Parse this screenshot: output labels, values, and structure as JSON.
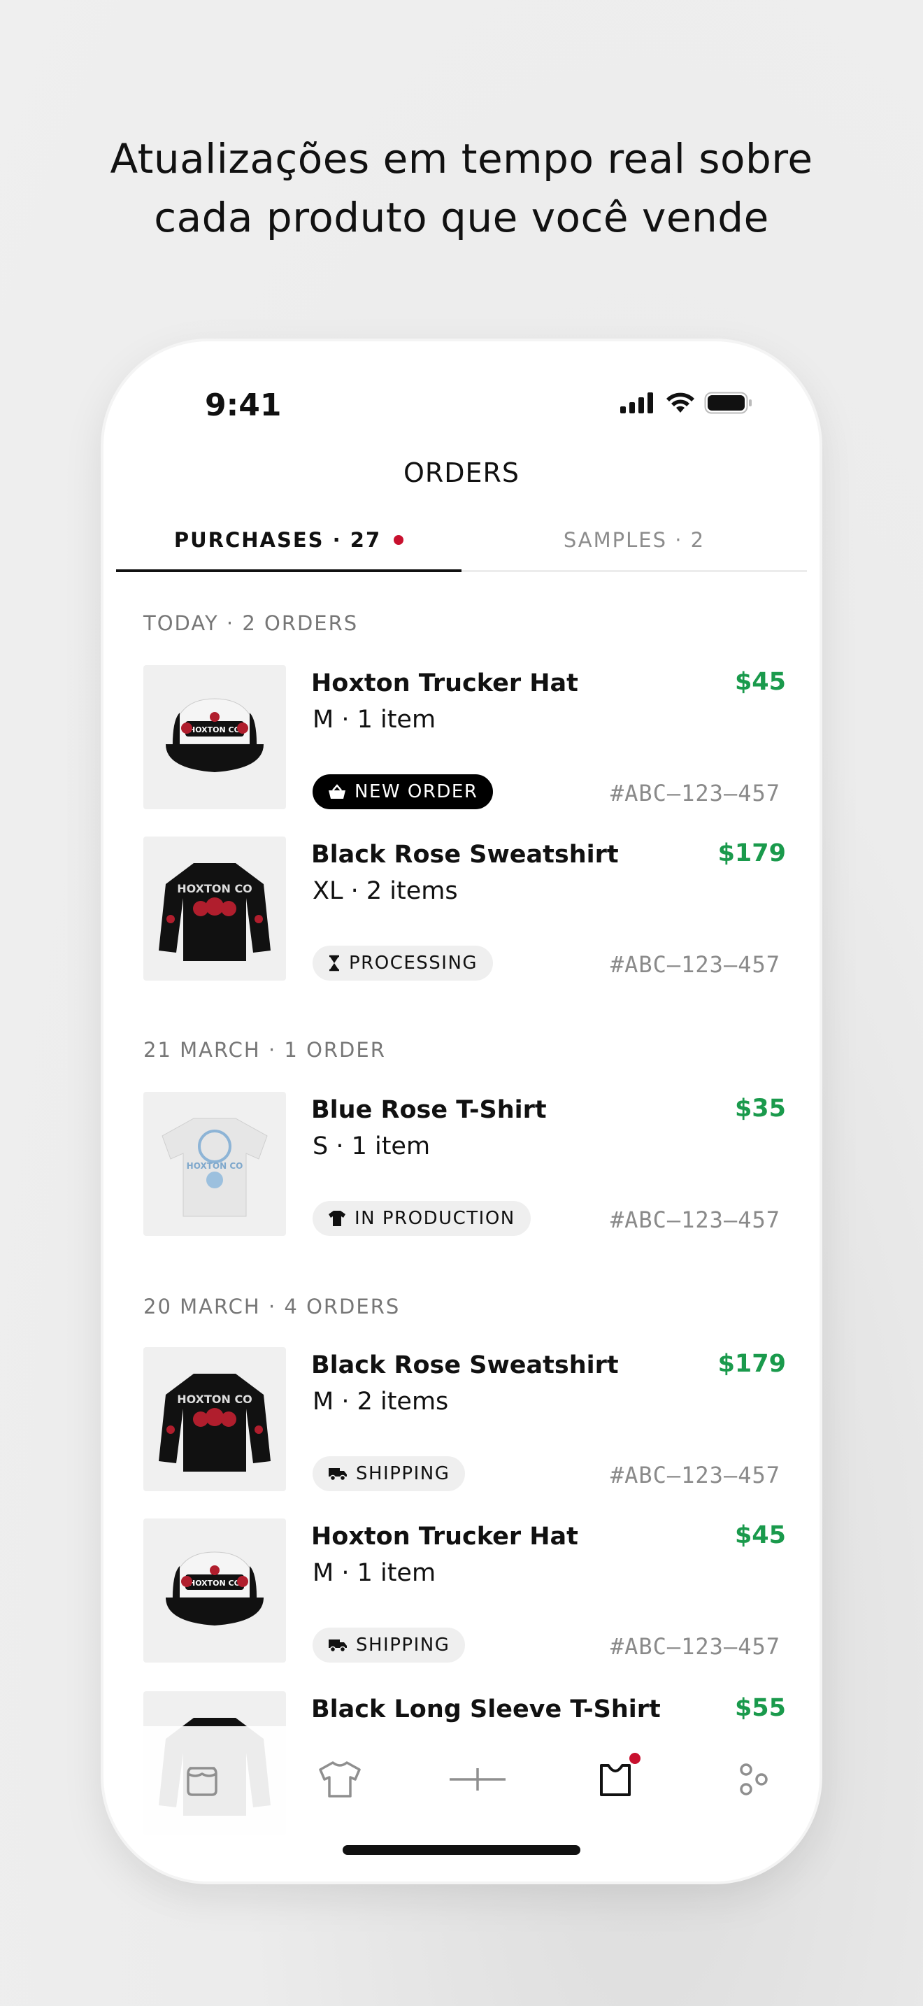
{
  "headline": {
    "line1": "Atualizações em tempo real sobre",
    "line2": "cada produto que você vende"
  },
  "status_bar": {
    "time": "9:41"
  },
  "nav": {
    "title": "ORDERS"
  },
  "tabs": [
    {
      "label": "PURCHASES · 27",
      "active": true,
      "has_dot": true
    },
    {
      "label": "SAMPLES · 2",
      "active": false,
      "has_dot": false
    }
  ],
  "sections": [
    {
      "title": "TODAY · 2 ORDERS"
    },
    {
      "title": "21 MARCH · 1 ORDER"
    },
    {
      "title": "20 MARCH · 4 ORDERS"
    }
  ],
  "orders": [
    {
      "name": "Hoxton Trucker Hat",
      "detail": "M  ·  1 item",
      "price": "$45",
      "status": "NEW ORDER",
      "status_icon": "basket-icon",
      "status_dark": true,
      "order_id": "#ABC–123–457",
      "thumb": "trucker-hat"
    },
    {
      "name": "Black Rose Sweatshirt",
      "detail": "XL  ·  2 items",
      "price": "$179",
      "status": "PROCESSING",
      "status_icon": "hourglass-icon",
      "status_dark": false,
      "order_id": "#ABC–123–457",
      "thumb": "sweatshirt"
    },
    {
      "name": "Blue Rose T-Shirt",
      "detail": "S  ·  1 item",
      "price": "$35",
      "status": "IN PRODUCTION",
      "status_icon": "tshirt-icon",
      "status_dark": false,
      "order_id": "#ABC–123–457",
      "thumb": "tshirt"
    },
    {
      "name": "Black Rose Sweatshirt",
      "detail": "M  ·  2 items",
      "price": "$179",
      "status": "SHIPPING",
      "status_icon": "truck-icon",
      "status_dark": false,
      "order_id": "#ABC–123–457",
      "thumb": "sweatshirt"
    },
    {
      "name": "Hoxton Trucker Hat",
      "detail": "M  ·  1 item",
      "price": "$45",
      "status": "SHIPPING",
      "status_icon": "truck-icon",
      "status_dark": false,
      "order_id": "#ABC–123–457",
      "thumb": "trucker-hat"
    },
    {
      "name": "Black Long Sleeve T-Shirt",
      "price": "$55"
    }
  ],
  "tabbar": [
    {
      "icon": "store-icon"
    },
    {
      "icon": "tshirt-outline-icon"
    },
    {
      "icon": "plus-icon"
    },
    {
      "icon": "orders-bag-icon",
      "active": true,
      "has_dot": true
    },
    {
      "icon": "more-dots-icon"
    }
  ],
  "colors": {
    "price_green": "#1a9a4c",
    "notification_red": "#c8102e"
  },
  "thumb_text": {
    "brand": "HOXTON CO"
  }
}
